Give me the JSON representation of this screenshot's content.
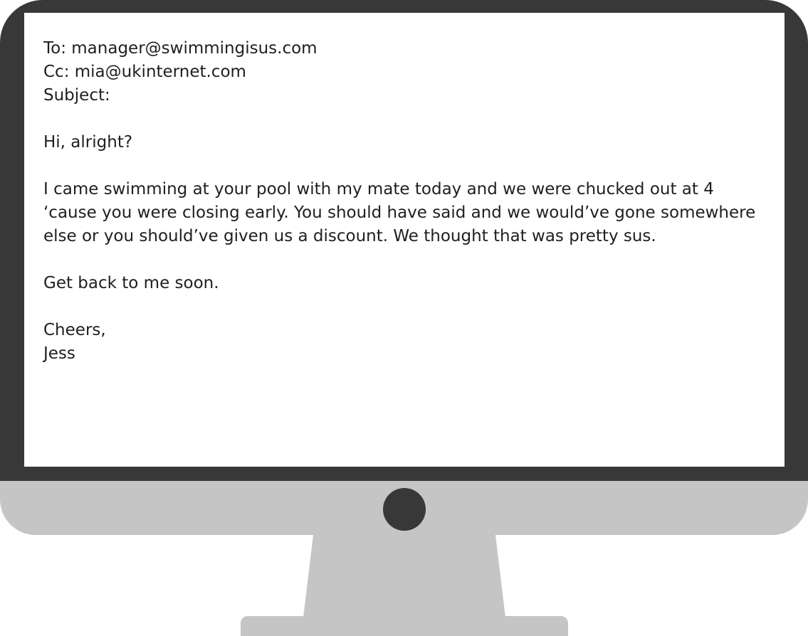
{
  "email": {
    "to_line": "To: manager@swimmingisus.com",
    "cc_line": "Cc: mia@ukinternet.com",
    "subject_line": "Subject:",
    "greeting": "Hi, alright?",
    "body": "I came swimming at your pool with my mate today and we were chucked out at 4 ‘cause you were closing early. You should have said and we would’ve gone somewhere else or you should’ve given us a discount. We thought that was pretty sus.",
    "closing_request": "Get back to me soon.",
    "sign_off": "Cheers,",
    "signature": "Jess"
  },
  "colors": {
    "bezel": "#383838",
    "chin": "#c6c5c6",
    "screen": "#ffffff",
    "text": "#1f1f1f"
  }
}
